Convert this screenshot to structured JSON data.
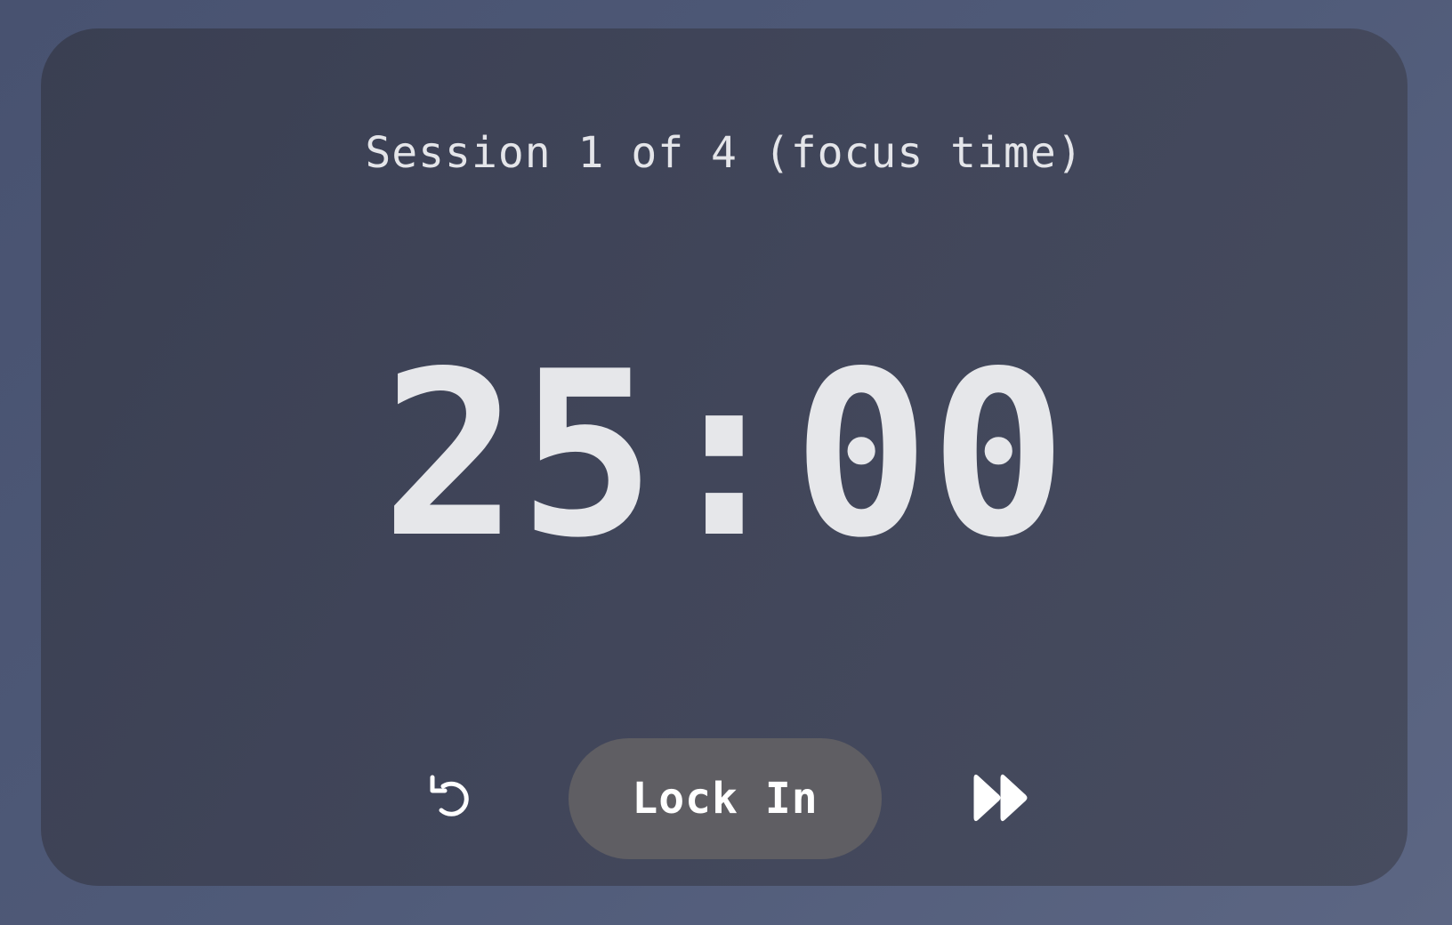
{
  "session": {
    "label": "Session 1 of 4 (focus time)"
  },
  "timer": {
    "display": "25:00"
  },
  "controls": {
    "reset_icon": "reset-icon",
    "primary_label": "Lock In",
    "skip_icon": "skip-forward-icon"
  },
  "colors": {
    "page_background": "#4f5a78",
    "card_background": "#41465a",
    "primary_button": "#5f5e63",
    "text": "#e6e7ea"
  }
}
